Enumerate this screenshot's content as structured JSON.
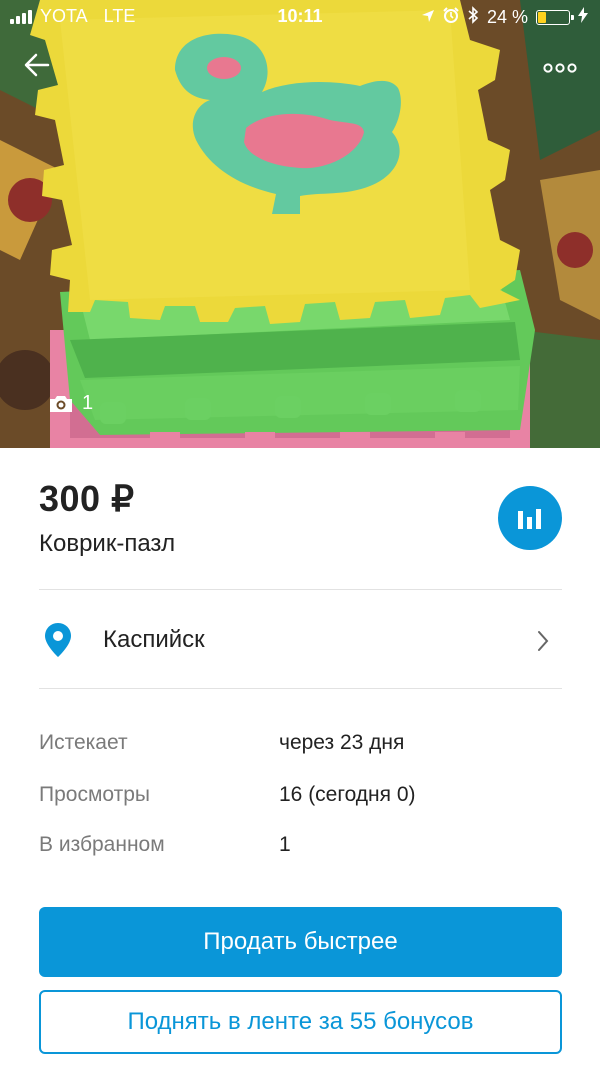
{
  "status_bar": {
    "carrier": "YOTA",
    "network": "LTE",
    "time": "10:11",
    "battery_text": "24 %",
    "battery_level": 0.24,
    "battery_color": "#ffd21f"
  },
  "header": {
    "back_icon": "arrow-left-icon",
    "more_icon": "more-dots-icon"
  },
  "gallery": {
    "photo_count": "1",
    "camera_icon": "camera-icon"
  },
  "listing": {
    "price": "300 ₽",
    "title": "Коврик-пазл",
    "stats_icon": "bar-chart-icon",
    "location": "Каспийск",
    "location_icon": "location-pin-icon",
    "chevron_icon": "chevron-right-icon"
  },
  "details": [
    {
      "label": "Истекает",
      "value": "через 23 дня"
    },
    {
      "label": "Просмотры",
      "value": "16 (сегодня 0)"
    },
    {
      "label": "В избранном",
      "value": "1"
    }
  ],
  "actions": {
    "sell_faster": "Продать быстрее",
    "bump": "Поднять в ленте за 55 бонусов"
  },
  "colors": {
    "accent": "#0a96d8",
    "label_gray": "#7a7a7a",
    "divider": "#e2e2e2"
  }
}
